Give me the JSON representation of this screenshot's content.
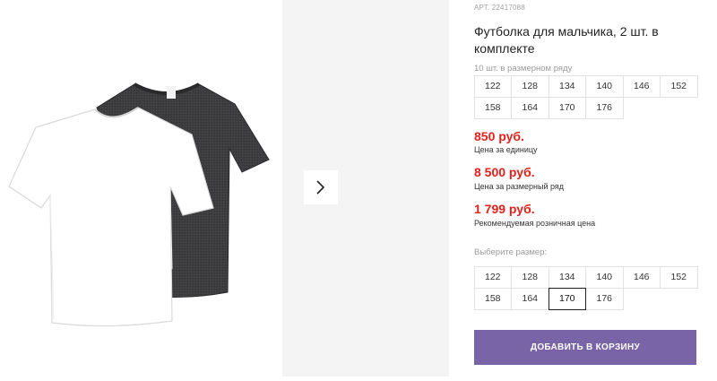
{
  "gallery": {
    "image_alt": "",
    "next_icon": "chevron-right-icon"
  },
  "product": {
    "article": "АРТ. 22417088",
    "title": "Футболка для мальчика, 2 шт. в комплекте"
  },
  "size_range": {
    "label": "10 шт. в размерном ряду",
    "sizes": [
      "122",
      "128",
      "134",
      "140",
      "146",
      "152",
      "158",
      "164",
      "170",
      "176"
    ]
  },
  "prices": [
    {
      "value": "850 руб.",
      "note": "Цена за единицу"
    },
    {
      "value": "8 500 руб.",
      "note": "Цена за размерный ряд"
    },
    {
      "value": "1 799 руб.",
      "note": "Рекомендуемая розничная цена"
    }
  ],
  "size_select": {
    "label": "Выберите размер:",
    "sizes": [
      "122",
      "128",
      "134",
      "140",
      "146",
      "152",
      "158",
      "164",
      "170",
      "176"
    ],
    "selected": "170"
  },
  "cart": {
    "button_label": "ДОБАВИТЬ В КОРЗИНУ"
  },
  "colors": {
    "price_red": "#e4211b",
    "button_purple": "#7a64a8",
    "shirt_dark": "#3b3b3d",
    "shirt_white": "#ffffff"
  }
}
